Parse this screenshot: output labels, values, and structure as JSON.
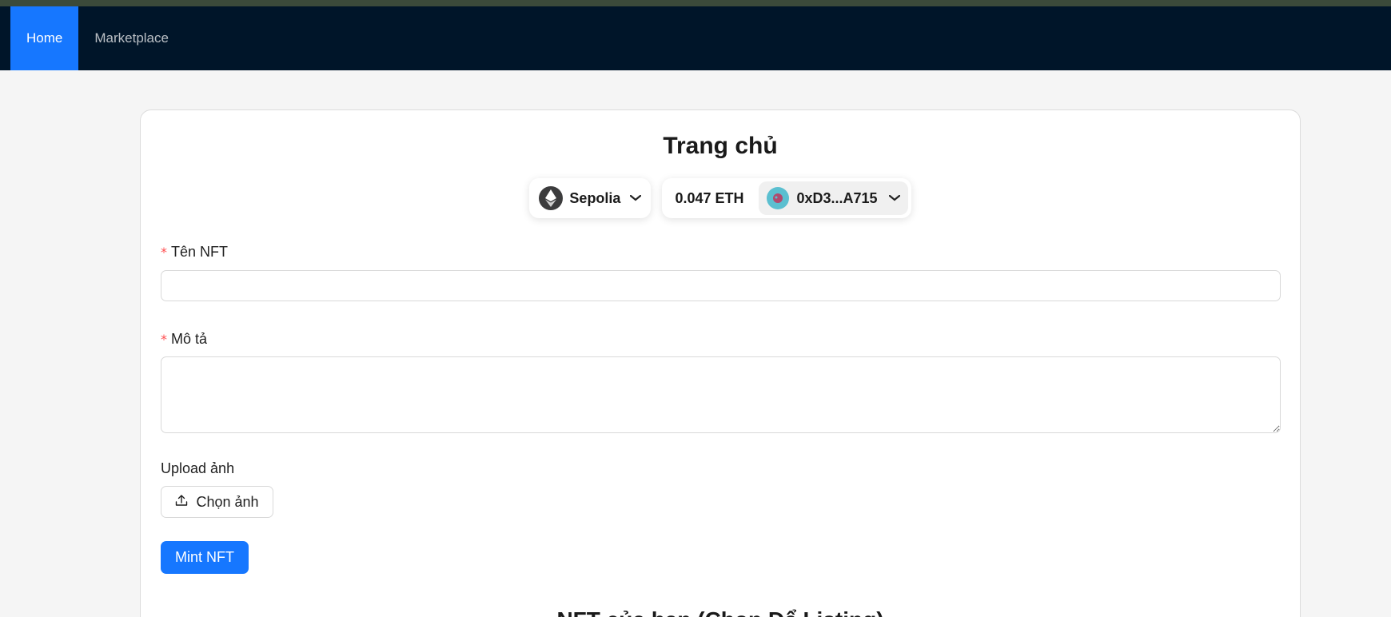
{
  "nav": {
    "items": [
      {
        "label": "Home",
        "active": true
      },
      {
        "label": "Marketplace",
        "active": false
      }
    ]
  },
  "page": {
    "title": "Trang chủ"
  },
  "wallet": {
    "network": "Sepolia",
    "network_icon": "ethereum-icon",
    "balance": "0.047 ETH",
    "address": "0xD3...A715",
    "avatar_icon": "account-avatar-icon"
  },
  "form": {
    "name_label": "Tên NFT",
    "name_value": "",
    "description_label": "Mô tả",
    "description_value": "",
    "required_mark": "*",
    "upload_label": "Upload ảnh",
    "upload_button": "Chọn ảnh",
    "mint_button": "Mint NFT"
  },
  "section": {
    "owned_title": "NFT của bạn (Chọn Để Listing)"
  },
  "colors": {
    "nav_bg": "#001529",
    "primary": "#1677ff",
    "required": "#ff4d4f",
    "page_bg": "#f5f5f5"
  }
}
